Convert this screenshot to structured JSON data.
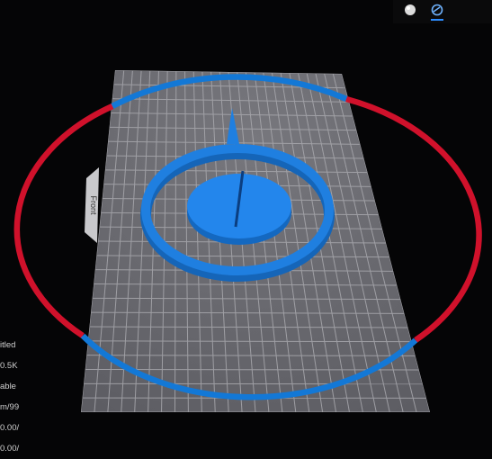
{
  "viewport": {
    "front_tab_label": "Front",
    "colors": {
      "background": "#050506",
      "plate": "#6e6e74",
      "grid": "#a9a9ae",
      "ring_blue": "#1378d6",
      "ring_red": "#d0112b",
      "model_blue": "#1f7fe0"
    }
  },
  "toolbar": {
    "solid_view_icon": "sphere-solid-icon",
    "wireframe_view_icon": "sphere-wireframe-icon",
    "active": "wireframe"
  },
  "info_panel": {
    "lines": [
      "itled",
      "0.5K",
      "able",
      "m/99",
      "/0.00",
      "/0.00"
    ]
  }
}
